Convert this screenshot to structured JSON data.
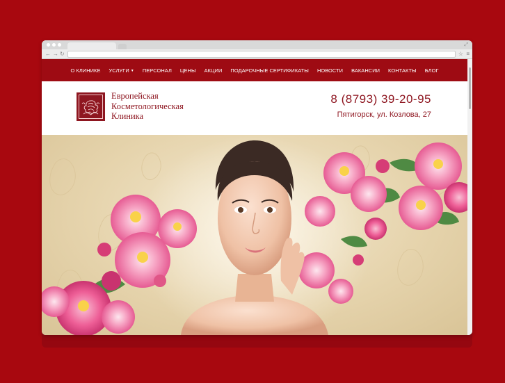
{
  "nav": {
    "items": [
      {
        "label": "О КЛИНИКЕ"
      },
      {
        "label": "УСЛУГИ",
        "dropdown": true
      },
      {
        "label": "ПЕРСОНАЛ"
      },
      {
        "label": "ЦЕНЫ"
      },
      {
        "label": "АКЦИИ"
      },
      {
        "label": "ПОДАРОЧНЫЕ СЕРТИФИКАТЫ"
      },
      {
        "label": "НОВОСТИ"
      },
      {
        "label": "ВАКАНСИИ"
      },
      {
        "label": "КОНТАКТЫ"
      },
      {
        "label": "БЛОГ"
      }
    ]
  },
  "header": {
    "logo_lines": [
      "Европейская",
      "Косметологическая",
      "Клиника"
    ],
    "phone": "8 (8793) 39-20-95",
    "address": "Пятигорск, ул. Козлова, 27"
  },
  "colors": {
    "page_background": "#a8080f",
    "brand": "#8e1620",
    "nav_background": "#9e0b13",
    "hero_background": "#e6d4ad",
    "peony_pink": "#f07aa8"
  },
  "icons": {
    "browser": [
      "back-arrow-icon",
      "forward-arrow-icon",
      "reload-icon",
      "bookmark-star-icon",
      "menu-icon",
      "resize-icon"
    ],
    "logo": "peony-logo-icon"
  }
}
